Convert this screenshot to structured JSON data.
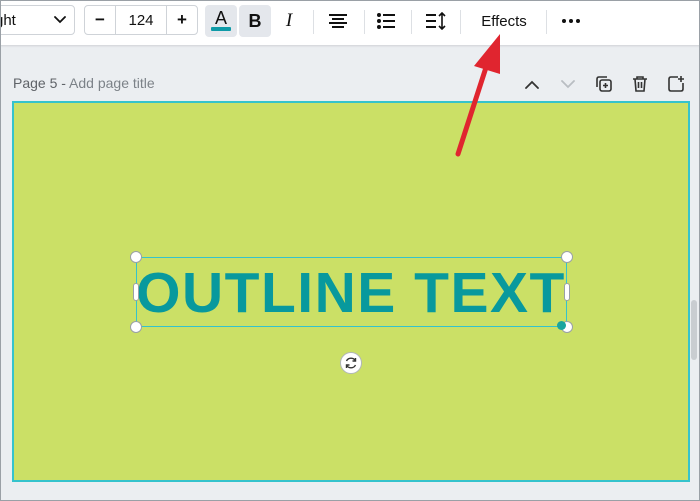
{
  "toolbar": {
    "font_name": "ght",
    "font_size": "124",
    "decrease_label": "−",
    "increase_label": "+",
    "text_color_glyph": "A",
    "text_color": "#0e9aa7",
    "bold_label": "B",
    "italic_label": "I",
    "effects_label": "Effects"
  },
  "page": {
    "label": "Page 5 - ",
    "title_placeholder": "Add page title",
    "actions": [
      "chevron-up-icon",
      "chevron-down-icon",
      "duplicate-icon",
      "trash-icon",
      "add-page-icon"
    ]
  },
  "canvas": {
    "background": "#cbe066",
    "text": "OUTLINE TEXT",
    "text_color": "#08999d"
  },
  "annotation": {
    "arrow_color": "#e0252f",
    "points_to": "Effects"
  }
}
